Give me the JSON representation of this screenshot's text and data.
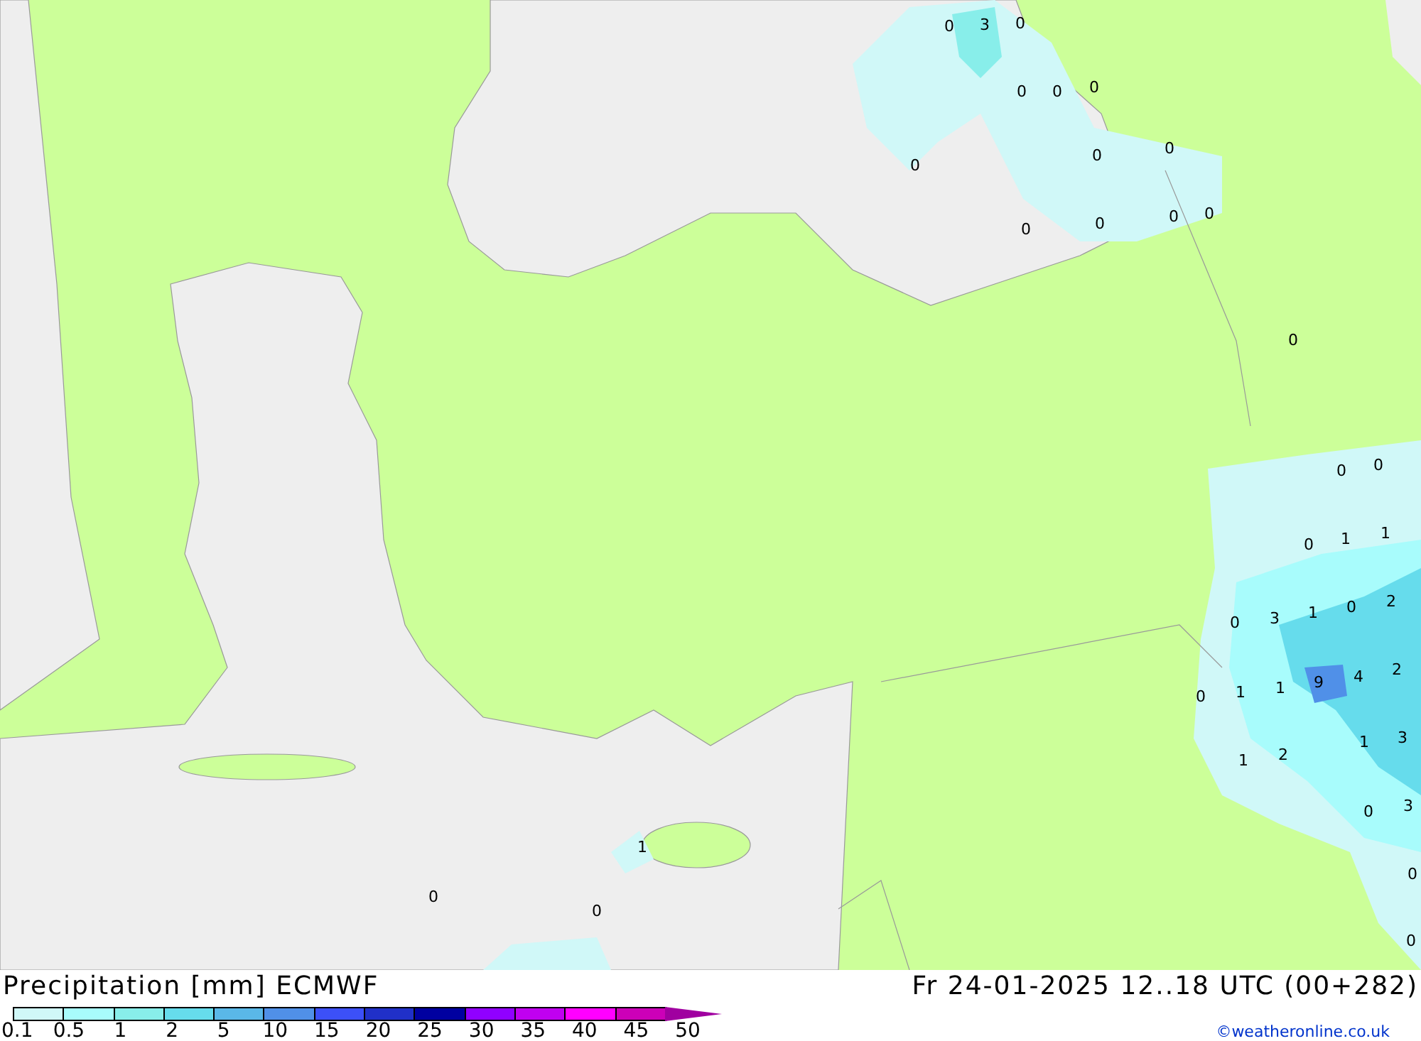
{
  "map": {
    "value_labels": [
      "0",
      "3",
      "0",
      "0",
      "0",
      "0",
      "0",
      "0",
      "0",
      "0",
      "0",
      "0",
      "0",
      "0",
      "0",
      "0",
      "0",
      "1",
      "1",
      "0",
      "3",
      "1",
      "0",
      "2",
      "0",
      "1",
      "1",
      "9",
      "4",
      "2",
      "1",
      "3",
      "1",
      "2",
      "0",
      "3",
      "1",
      "0",
      "0",
      "0",
      "0"
    ]
  },
  "footer": {
    "title": "Precipitation [mm] ECMWF",
    "valid_time": "Fr 24-01-2025 12..18 UTC (00+282)",
    "credit": "©weatheronline.co.uk"
  },
  "legend": {
    "bins": [
      {
        "color": "#d0f8f8"
      },
      {
        "color": "#a8fcfc"
      },
      {
        "color": "#88eeea"
      },
      {
        "color": "#66dcec"
      },
      {
        "color": "#5ab8e8"
      },
      {
        "color": "#5090e8"
      },
      {
        "color": "#3c50f8"
      },
      {
        "color": "#2030c8"
      },
      {
        "color": "#0000a0"
      },
      {
        "color": "#9000ff"
      },
      {
        "color": "#c000f0"
      },
      {
        "color": "#ff00ff"
      },
      {
        "color": "#cc00b8"
      },
      {
        "kind": "arrow",
        "color": "#a000a0"
      }
    ],
    "labels": [
      "0.1",
      "0.5",
      "1",
      "2",
      "5",
      "10",
      "15",
      "20",
      "25",
      "30",
      "35",
      "40",
      "45",
      "50"
    ]
  }
}
